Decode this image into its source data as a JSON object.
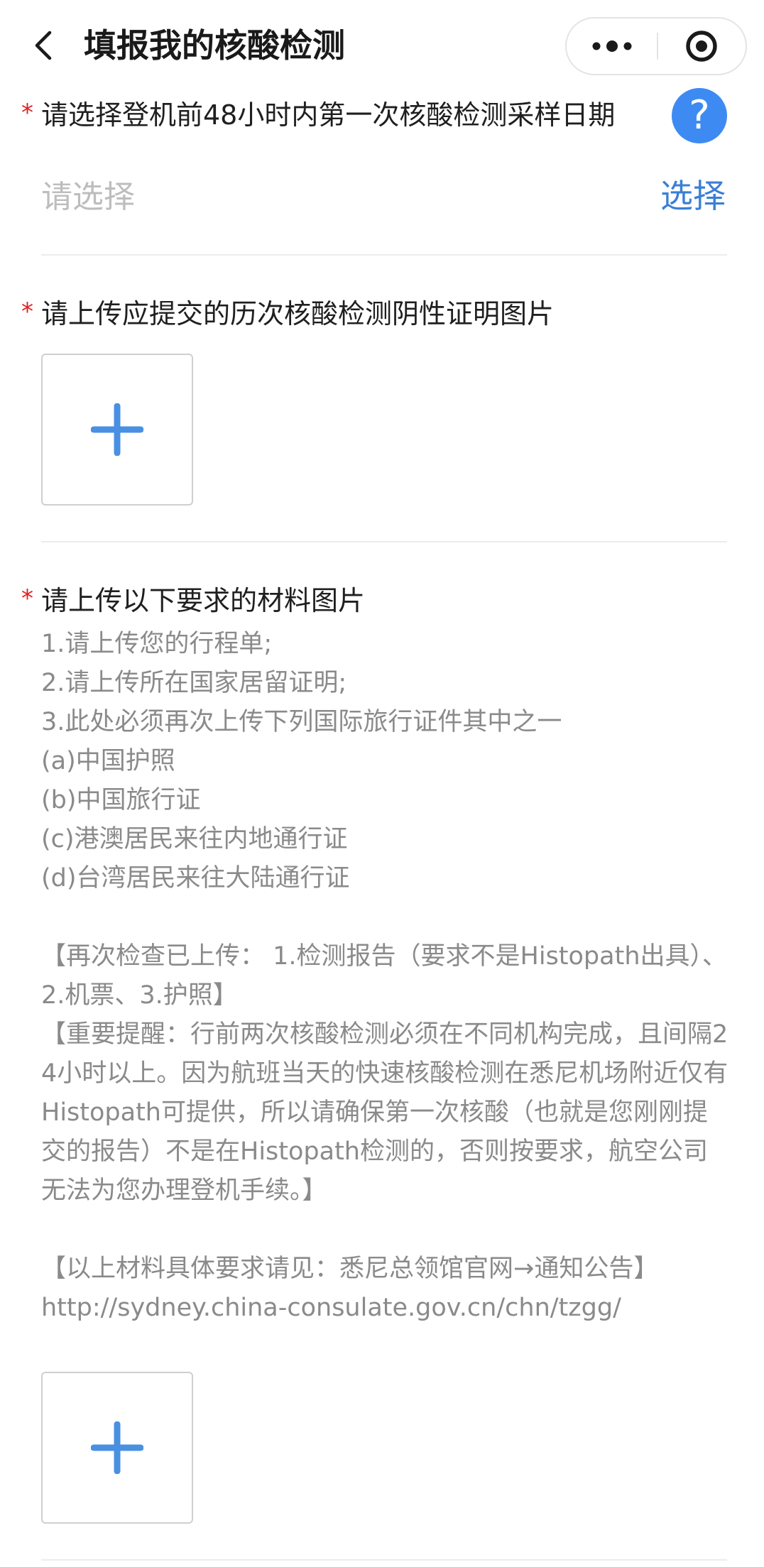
{
  "nav": {
    "title": "填报我的核酸检测",
    "back_icon": "chevron-left-icon",
    "more_icon": "more-dots-icon",
    "close_icon": "target-close-icon"
  },
  "form": {
    "required_mark": "*",
    "date_field": {
      "label": "请选择登机前48小时内第一次核酸检测采样日期",
      "help": "?",
      "placeholder": "请选择",
      "choose_label": "选择"
    },
    "history_upload": {
      "label": "请上传应提交的历次核酸检测阴性证明图片"
    },
    "materials_upload": {
      "label": "请上传以下要求的材料图片",
      "lines": [
        "1.请上传您的行程单;",
        "2.请上传所在国家居留证明;",
        "3.此处必须再次上传下列国际旅行证件其中之一",
        "(a)中国护照",
        "(b)中国旅行证",
        "(c)港澳居民来往内地通行证",
        "(d)台湾居民来往大陆通行证"
      ],
      "recheck": "【再次检查已上传： 1.检测报告（要求不是Histopath出具）、2.机票、3.护照】",
      "reminder": "【重要提醒：行前两次核酸检测必须在不同机构完成，且间隔24小时以上。因为航班当天的快速核酸检测在悉尼机场附近仅有Histopath可提供，所以请确保第一次核酸（也就是您刚刚提交的报告）不是在Histopath检测的，否则按要求，航空公司无法为您办理登机手续。】",
      "reference": "【以上材料具体要求请见：悉尼总领馆官网→通知公告】",
      "url": "http://sydney.china-consulate.gov.cn/chn/tzgg/"
    },
    "upload_icon": "plus-icon"
  },
  "colors": {
    "accent": "#3a7fd5",
    "help_badge": "#3d8bf2",
    "required": "#e02020",
    "plus": "#4a90e2"
  }
}
